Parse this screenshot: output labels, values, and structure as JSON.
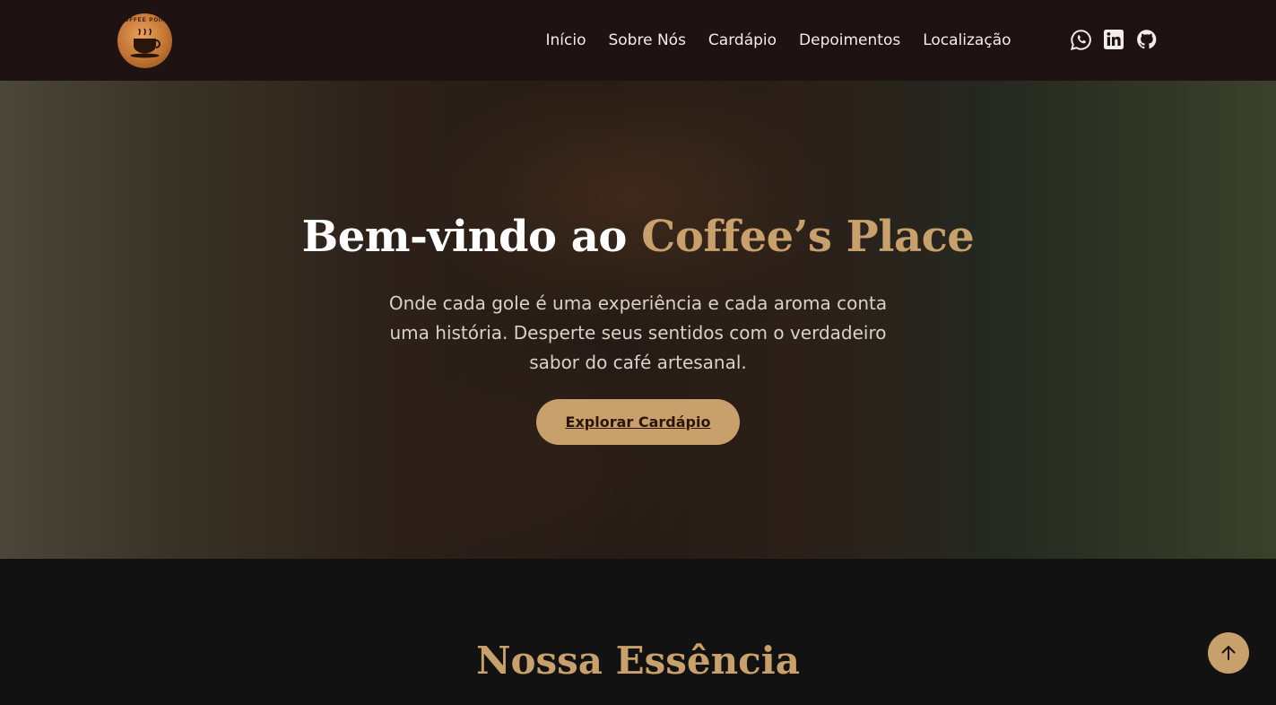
{
  "brand": {
    "logo_text": "COFFEE POINT"
  },
  "nav": {
    "links": [
      "Início",
      "Sobre Nós",
      "Cardápio",
      "Depoimentos",
      "Localização"
    ]
  },
  "socials": [
    "whatsapp-icon",
    "linkedin-icon",
    "github-icon"
  ],
  "hero": {
    "title_prefix": "Bem-vindo ao ",
    "title_accent": "Coffee’s Place",
    "subtitle": "Onde cada gole é uma experiência e cada aroma conta uma história. Desperte seus sentidos com o verdadeiro sabor do café artesanal.",
    "button_label": "Explorar Cardápio"
  },
  "section": {
    "title": "Nossa Essência"
  },
  "colors": {
    "accent": "#c8a06b",
    "navbar": "#1e1212",
    "page_bg": "#131212"
  }
}
